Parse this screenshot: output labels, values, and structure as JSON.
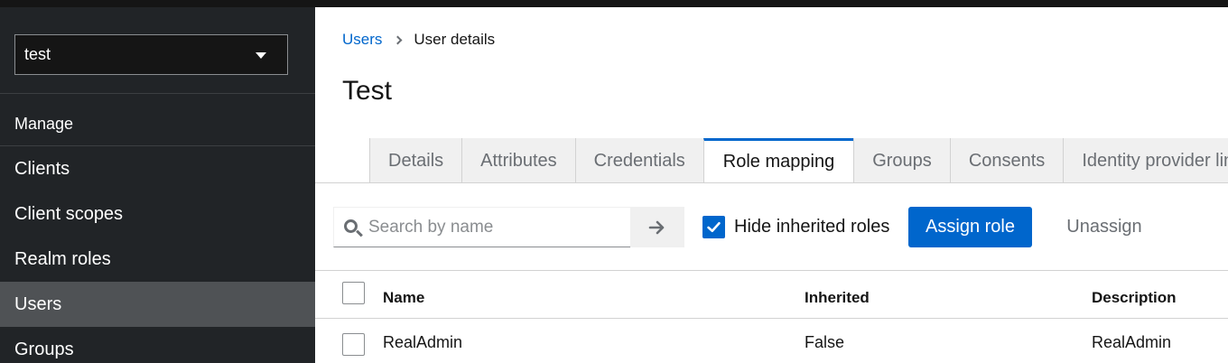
{
  "sidebar": {
    "realm_selected": "test",
    "section_label": "Manage",
    "items": [
      {
        "label": "Clients"
      },
      {
        "label": "Client scopes"
      },
      {
        "label": "Realm roles"
      },
      {
        "label": "Users",
        "active": true
      },
      {
        "label": "Groups"
      }
    ]
  },
  "breadcrumb": {
    "parent": "Users",
    "current": "User details"
  },
  "page": {
    "title": "Test"
  },
  "tabs": [
    {
      "label": "Details"
    },
    {
      "label": "Attributes"
    },
    {
      "label": "Credentials"
    },
    {
      "label": "Role mapping",
      "active": true
    },
    {
      "label": "Groups"
    },
    {
      "label": "Consents"
    },
    {
      "label": "Identity provider links"
    }
  ],
  "toolbar": {
    "search_placeholder": "Search by name",
    "search_value": "",
    "hide_inherited_label": "Hide inherited roles",
    "hide_inherited_checked": true,
    "assign_label": "Assign role",
    "unassign_label": "Unassign"
  },
  "table": {
    "columns": [
      "Name",
      "Inherited",
      "Description"
    ],
    "rows": [
      {
        "name": "RealAdmin",
        "inherited": "False",
        "description": "RealAdmin",
        "checked": false
      }
    ]
  },
  "colors": {
    "accent": "#0066cc",
    "sidebar_bg": "#212427",
    "sidebar_active": "#4f5255"
  },
  "icons": {
    "search": "search-icon",
    "arrow": "arrow-right-icon",
    "caret": "caret-down-icon",
    "check": "check-icon",
    "breadcrumb_sep": "chevron-right-icon"
  }
}
